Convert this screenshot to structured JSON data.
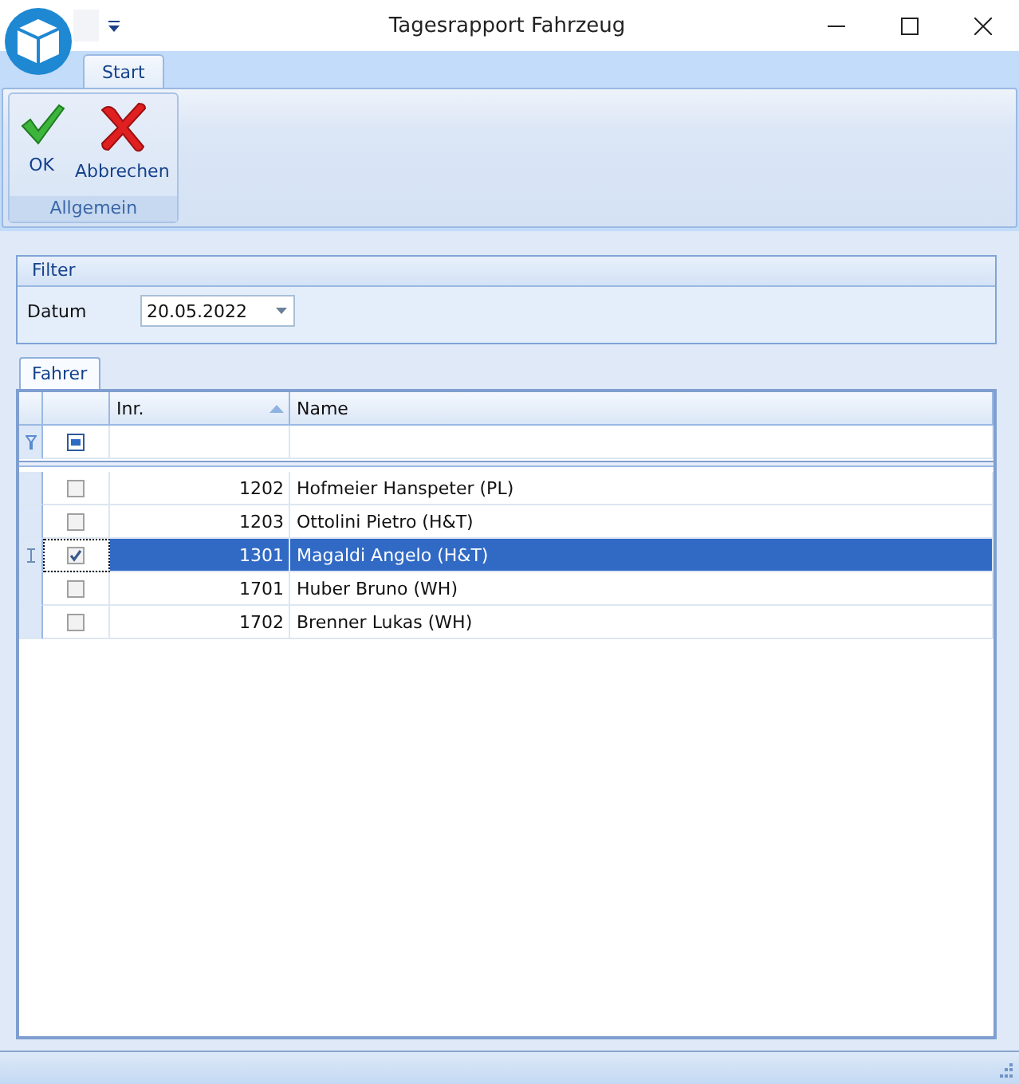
{
  "window": {
    "title": "Tagesrapport Fahrzeug"
  },
  "ribbon": {
    "tabs": [
      {
        "label": "Start",
        "selected": true
      }
    ],
    "groups": [
      {
        "label": "Allgemein",
        "buttons": [
          {
            "label": "OK",
            "kind": "ok"
          },
          {
            "label": "Abbrechen",
            "kind": "cancel"
          }
        ]
      }
    ]
  },
  "filter": {
    "title": "Filter",
    "fields": [
      {
        "label": "Datum",
        "value": "20.05.2022"
      }
    ]
  },
  "tabs": [
    {
      "label": "Fahrer",
      "selected": true
    }
  ],
  "grid": {
    "select_all_partial": true,
    "columns": [
      {
        "label": "Inr.",
        "sorted": true
      },
      {
        "label": "Name",
        "sorted": false
      }
    ],
    "rows": [
      {
        "inr": "1202",
        "name": "Hofmeier Hanspeter (PL)",
        "checked": false,
        "selected": false
      },
      {
        "inr": "1203",
        "name": "Ottolini Pietro (H&T)",
        "checked": false,
        "selected": false
      },
      {
        "inr": "1301",
        "name": "Magaldi Angelo (H&T)",
        "checked": true,
        "selected": true
      },
      {
        "inr": "1701",
        "name": "Huber Bruno (WH)",
        "checked": false,
        "selected": false
      },
      {
        "inr": "1702",
        "name": "Brenner Lukas (WH)",
        "checked": false,
        "selected": false
      }
    ]
  }
}
